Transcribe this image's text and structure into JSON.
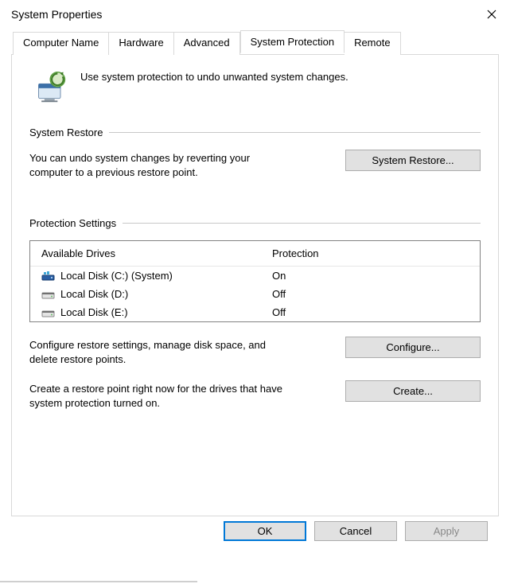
{
  "window": {
    "title": "System Properties"
  },
  "tabs": [
    {
      "label": "Computer Name"
    },
    {
      "label": "Hardware"
    },
    {
      "label": "Advanced"
    },
    {
      "label": "System Protection"
    },
    {
      "label": "Remote"
    }
  ],
  "intro": {
    "text": "Use system protection to undo unwanted system changes."
  },
  "restore": {
    "group_title": "System Restore",
    "desc": "You can undo system changes by reverting your computer to a previous restore point.",
    "button": "System Restore..."
  },
  "protection": {
    "group_title": "Protection Settings",
    "col_drive": "Available Drives",
    "col_prot": "Protection",
    "drives": [
      {
        "name": "Local Disk (C:) (System)",
        "protection": "On",
        "system": true
      },
      {
        "name": "Local Disk (D:)",
        "protection": "Off",
        "system": false
      },
      {
        "name": "Local Disk (E:)",
        "protection": "Off",
        "system": false
      }
    ],
    "configure_desc": "Configure restore settings, manage disk space, and delete restore points.",
    "configure_btn": "Configure...",
    "create_desc": "Create a restore point right now for the drives that have system protection turned on.",
    "create_btn": "Create..."
  },
  "footer": {
    "ok": "OK",
    "cancel": "Cancel",
    "apply": "Apply"
  }
}
